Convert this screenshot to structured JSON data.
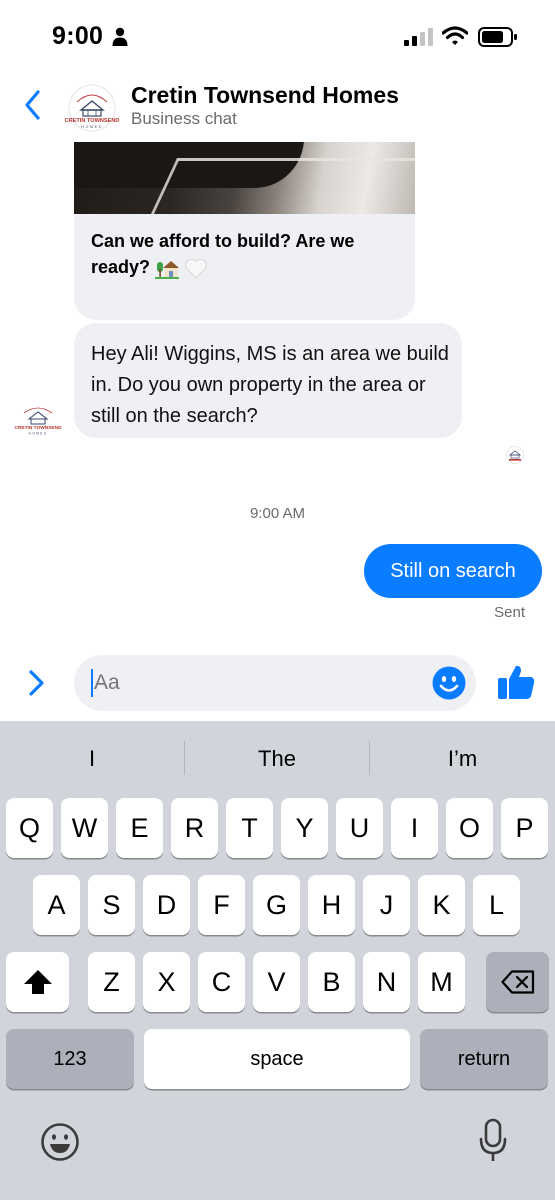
{
  "status_bar": {
    "time": "9:00"
  },
  "header": {
    "title": "Cretin Townsend Homes",
    "subtitle": "Business chat",
    "logo_lines": [
      "CRETIN TOWNSEND",
      "HOMES"
    ]
  },
  "messages": {
    "card_text": "Can we afford to build? Are we ready?",
    "incoming_text": "Hey Ali! Wiggins, MS is an area we build in. Do you own property in the area or still on the search?",
    "timestamp": "9:00 AM",
    "outgoing_text": "Still on search",
    "outgoing_status": "Sent"
  },
  "composer": {
    "placeholder": "Aa"
  },
  "keyboard": {
    "suggestions": [
      "I",
      "The",
      "I’m"
    ],
    "row1": [
      "Q",
      "W",
      "E",
      "R",
      "T",
      "Y",
      "U",
      "I",
      "O",
      "P"
    ],
    "row2": [
      "A",
      "S",
      "D",
      "F",
      "G",
      "H",
      "J",
      "K",
      "L"
    ],
    "row3": [
      "Z",
      "X",
      "C",
      "V",
      "B",
      "N",
      "M"
    ],
    "numbers_key": "123",
    "space_key": "space",
    "return_key": "return"
  },
  "colors": {
    "accent": "#0a7cff",
    "bubble_incoming": "#eff0f4",
    "keyboard_bg": "#d1d4da"
  },
  "icons": [
    "person-icon",
    "signal-icon",
    "wifi-icon",
    "battery-icon",
    "back-icon",
    "expand-icon",
    "emoji-icon",
    "like-icon",
    "shift-icon",
    "delete-icon",
    "microphone-icon"
  ]
}
